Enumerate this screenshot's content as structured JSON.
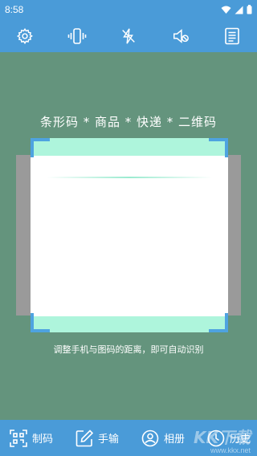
{
  "status_bar": {
    "time": "8:58"
  },
  "toolbar": {
    "items": [
      {
        "icon": "settings-icon"
      },
      {
        "icon": "vibrate-icon"
      },
      {
        "icon": "flash-off-icon"
      },
      {
        "icon": "sound-off-icon"
      },
      {
        "icon": "document-icon"
      }
    ]
  },
  "scan": {
    "title": "条形码 * 商品 * 快递 * 二维码",
    "hint": "调整手机与图码的距离，即可自动识别"
  },
  "bottom_nav": {
    "create_label": "制码",
    "manual_label": "手输",
    "album_label": "相册",
    "history_label": "历史"
  },
  "watermark": {
    "brand": "KK下载",
    "url": "www.kkx.net"
  },
  "colors": {
    "accent": "#4a9bd8",
    "background": "#64947d",
    "scan_band": "#aef5dc",
    "corner": "#4ea3e0"
  }
}
